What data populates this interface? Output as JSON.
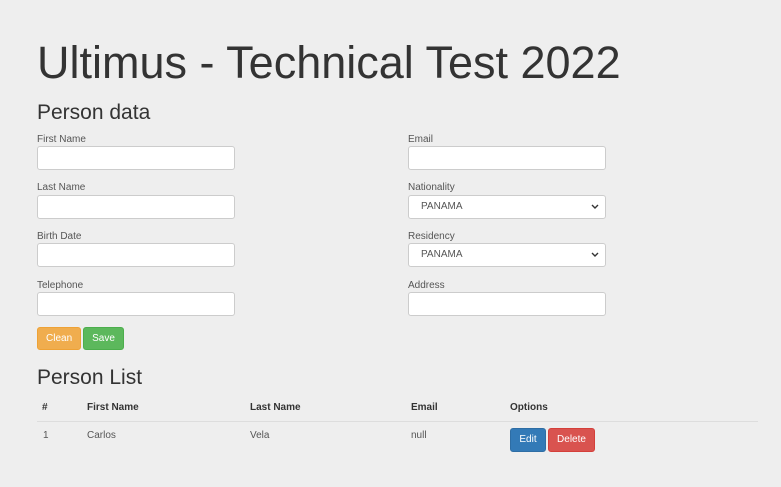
{
  "page": {
    "title": "Ultimus - Technical Test 2022"
  },
  "person_form": {
    "heading": "Person data",
    "fields": {
      "first_name": {
        "label": "First Name",
        "value": ""
      },
      "last_name": {
        "label": "Last Name",
        "value": ""
      },
      "birth_date": {
        "label": "Birth Date",
        "value": ""
      },
      "telephone": {
        "label": "Telephone",
        "value": ""
      },
      "email": {
        "label": "Email",
        "value": ""
      },
      "nationality": {
        "label": "Nationality",
        "selected": "PANAMA"
      },
      "residency": {
        "label": "Residency",
        "selected": "PANAMA"
      },
      "address": {
        "label": "Address",
        "value": ""
      }
    },
    "buttons": {
      "clean_label": "Clean",
      "save_label": "Save"
    }
  },
  "person_list": {
    "heading": "Person List",
    "columns": [
      "#",
      "First Name",
      "Last Name",
      "Email",
      "Options"
    ],
    "rows": [
      {
        "index": "1",
        "first_name": "Carlos",
        "last_name": "Vela",
        "email": "null",
        "edit_label": "Edit",
        "delete_label": "Delete"
      }
    ]
  },
  "colors": {
    "background": "#eeeeee",
    "clean_button": "#f0ad4e",
    "save_button": "#5cb85c",
    "edit_button": "#337ab7",
    "delete_button": "#d9534f"
  },
  "icons": {
    "select_caret": "chevron-down-icon"
  }
}
